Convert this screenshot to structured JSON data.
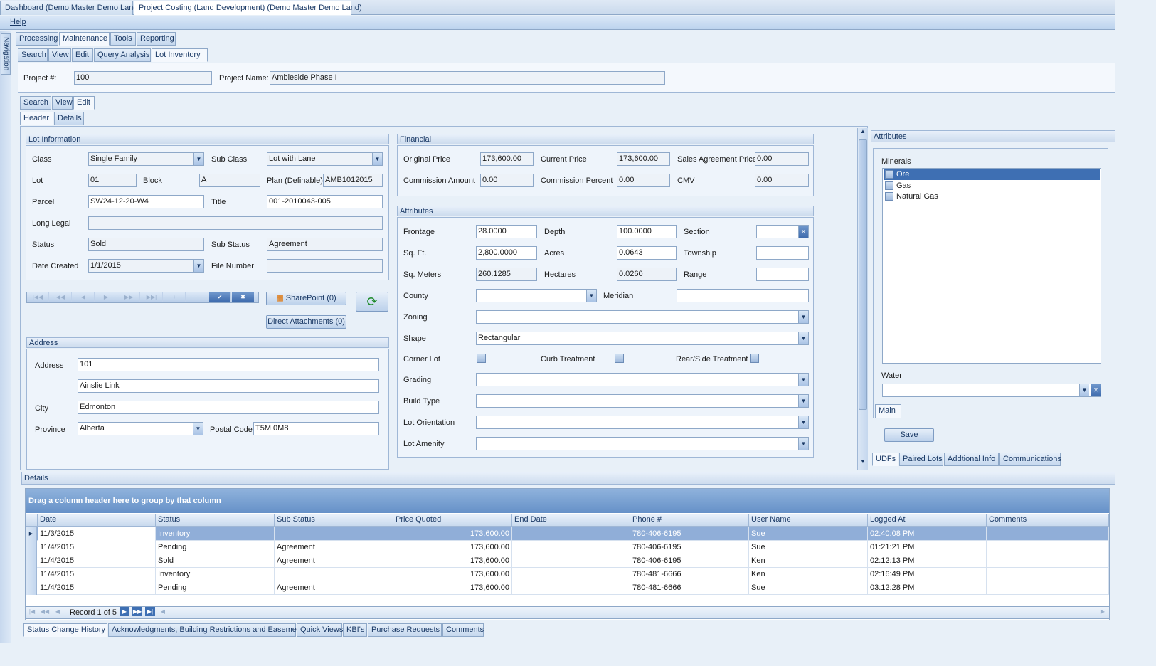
{
  "doc_tabs": [
    "Dashboard (Demo Master Demo Land)",
    "Project Costing (Land Development) (Demo Master Demo Land)"
  ],
  "menu": {
    "help": "Help"
  },
  "nav_label": "Navigation",
  "main_tabs": [
    "Processing",
    "Maintenance",
    "Tools",
    "Reporting"
  ],
  "sub_tabs": [
    "Search",
    "View",
    "Edit",
    "Query Analysis",
    "Lot Inventory"
  ],
  "project": {
    "number_label": "Project #:",
    "number": "100",
    "name_label": "Project Name:",
    "name": "Ambleside Phase I"
  },
  "mode_tabs": [
    "Search",
    "View",
    "Edit"
  ],
  "section_tabs": [
    "Header",
    "Details"
  ],
  "lot_info": {
    "title": "Lot Information",
    "class_label": "Class",
    "class": "Single Family",
    "subclass_label": "Sub Class",
    "subclass": "Lot with Lane",
    "lot_label": "Lot",
    "lot": "01",
    "block_label": "Block",
    "block": "A",
    "plan_label": "Plan (Definable)",
    "plan": "AMB1012015",
    "parcel_label": "Parcel",
    "parcel": "SW24-12-20-W4",
    "title_label": "Title",
    "title_value": "001-2010043-005",
    "long_legal_label": "Long Legal",
    "long_legal": "",
    "status_label": "Status",
    "status": "Sold",
    "substatus_label": "Sub Status",
    "substatus": "Agreement",
    "date_created_label": "Date Created",
    "date_created": "1/1/2015",
    "file_number_label": "File Number",
    "file_number": ""
  },
  "buttons": {
    "sharepoint": "SharePoint (0)",
    "direct_attachments": "Direct Attachments (0)",
    "save": "Save"
  },
  "address": {
    "title": "Address",
    "address_label": "Address",
    "address1": "101",
    "address2": "Ainslie Link",
    "city_label": "City",
    "city": "Edmonton",
    "province_label": "Province",
    "province": "Alberta",
    "postal_label": "Postal Code",
    "postal": "T5M 0M8"
  },
  "financial": {
    "title": "Financial",
    "original_price_label": "Original Price",
    "original_price": "173,600.00",
    "current_price_label": "Current Price",
    "current_price": "173,600.00",
    "sales_agreement_label": "Sales Agreement Price",
    "sales_agreement": "0.00",
    "commission_amount_label": "Commission Amount",
    "commission_amount": "0.00",
    "commission_percent_label": "Commission Percent",
    "commission_percent": "0.00",
    "cmv_label": "CMV",
    "cmv": "0.00"
  },
  "attributes": {
    "title": "Attributes",
    "frontage_label": "Frontage",
    "frontage": "28.0000",
    "depth_label": "Depth",
    "depth": "100.0000",
    "section_label": "Section",
    "section": "",
    "sqft_label": "Sq. Ft.",
    "sqft": "2,800.0000",
    "acres_label": "Acres",
    "acres": "0.0643",
    "township_label": "Township",
    "township": "",
    "sqm_label": "Sq. Meters",
    "sqm": "260.1285",
    "hectares_label": "Hectares",
    "hectares": "0.0260",
    "range_label": "Range",
    "range": "",
    "county_label": "County",
    "county": "",
    "meridian_label": "Meridian",
    "meridian": "",
    "zoning_label": "Zoning",
    "zoning": "",
    "shape_label": "Shape",
    "shape": "Rectangular",
    "corner_lot_label": "Corner Lot",
    "curb_label": "Curb Treatment",
    "rear_label": "Rear/Side Treatment",
    "grading_label": "Grading",
    "grading": "",
    "build_type_label": "Build Type",
    "build_type": "",
    "orientation_label": "Lot Orientation",
    "orientation": "",
    "amenity_label": "Lot Amenity",
    "amenity": ""
  },
  "right_panel": {
    "title": "Attributes",
    "minerals_label": "Minerals",
    "minerals": [
      "Ore",
      "Gas",
      "Natural Gas"
    ],
    "water_label": "Water",
    "main_tab": "Main",
    "bottom_tabs": [
      "UDFs",
      "Paired Lots",
      "Addtional Info",
      "Communications"
    ]
  },
  "details": {
    "title": "Details",
    "group_hint": "Drag a column header here to group by that column",
    "columns": [
      "Date",
      "Status",
      "Sub Status",
      "Price Quoted",
      "End Date",
      "Phone #",
      "User Name",
      "Logged At",
      "Comments"
    ],
    "rows": [
      [
        "11/3/2015",
        "Inventory",
        "",
        "173,600.00",
        "",
        "780-406-6195",
        "Sue",
        "02:40:08 PM",
        ""
      ],
      [
        "11/4/2015",
        "Pending",
        "Agreement",
        "173,600.00",
        "",
        "780-406-6195",
        "Sue",
        "01:21:21 PM",
        ""
      ],
      [
        "11/4/2015",
        "Sold",
        "Agreement",
        "173,600.00",
        "",
        "780-406-6195",
        "Ken",
        "02:12:13 PM",
        ""
      ],
      [
        "11/4/2015",
        "Inventory",
        "",
        "173,600.00",
        "",
        "780-481-6666",
        "Ken",
        "02:16:49 PM",
        ""
      ],
      [
        "11/4/2015",
        "Pending",
        "Agreement",
        "173,600.00",
        "",
        "780-481-6666",
        "Sue",
        "03:12:28 PM",
        ""
      ]
    ],
    "record_text": "Record 1 of 5",
    "bottom_tabs": [
      "Status Change History",
      "Acknowledgments, Building Restrictions and Easements",
      "Quick Views",
      "KBI's",
      "Purchase Requests",
      "Comments"
    ]
  },
  "colors": {
    "accent": "#6691c8",
    "selected_row": "#90aed8",
    "panel_bg": "#eef4fb",
    "border": "#8ea8c8"
  }
}
